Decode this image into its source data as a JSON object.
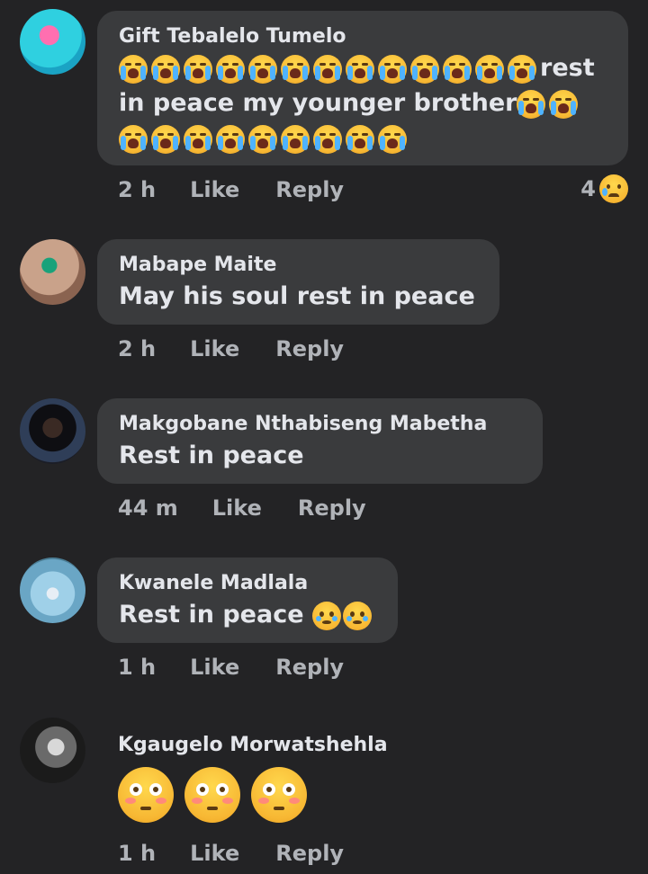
{
  "comments": [
    {
      "author": "Gift Tebalelo Tumelo",
      "line1_text": "rest",
      "line2_text": "in peace my younger brother",
      "time": "2 h",
      "like": "Like",
      "reply": "Reply",
      "reaction_count": "4",
      "reaction_icon": "sad-tear-icon"
    },
    {
      "author": "Mabape Maite",
      "text": "May his soul rest in peace",
      "time": "2 h",
      "like": "Like",
      "reply": "Reply"
    },
    {
      "author": "Makgobane Nthabiseng Mabetha",
      "text": "Rest in peace",
      "time": "44 m",
      "like": "Like",
      "reply": "Reply"
    },
    {
      "author": "Kwanele Madlala",
      "text": "Rest in peace",
      "time": "1 h",
      "like": "Like",
      "reply": "Reply"
    },
    {
      "author": "Kgaugelo Morwatshehla",
      "time": "1 h",
      "like": "Like",
      "reply": "Reply"
    }
  ],
  "colors": {
    "background": "#232325",
    "bubble": "#3a3b3d",
    "text": "#e4e6eb",
    "meta": "#b0b3b8"
  },
  "icons": [
    "loudly-crying-face-icon",
    "holding-back-tears-face-icon",
    "flushed-face-icon",
    "sad-tear-icon"
  ]
}
